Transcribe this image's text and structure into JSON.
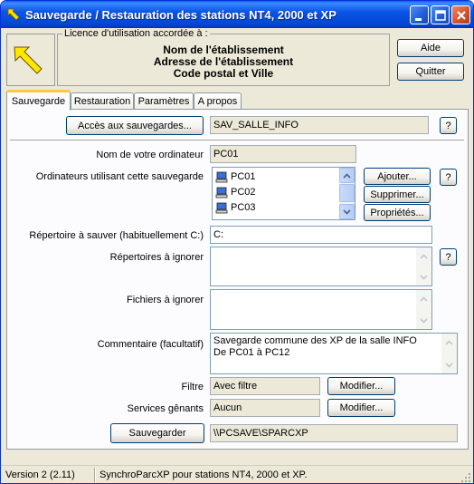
{
  "window": {
    "title": "Sauvegarde / Restauration des stations NT4, 2000 et XP"
  },
  "license": {
    "caption": "Licence d'utilisation accordée à :",
    "line1": "Nom de l'établissement",
    "line2": "Adresse de l'établissement",
    "line3": "Code postal et Ville"
  },
  "top_buttons": {
    "help": "Aide",
    "quit": "Quitter"
  },
  "tabs": [
    {
      "label": "Sauvegarde",
      "active": true
    },
    {
      "label": "Restauration",
      "active": false
    },
    {
      "label": "Paramètres",
      "active": false
    },
    {
      "label": "A propos",
      "active": false
    }
  ],
  "backup_access": {
    "button": "Accès aux sauvegardes...",
    "value": "SAV_SALLE_INFO",
    "help": "?"
  },
  "computer_name": {
    "label": "Nom de votre ordinateur",
    "value": "PC01"
  },
  "computers": {
    "label": "Ordinateurs utilisant cette sauvegarde",
    "items": [
      "PC01",
      "PC02",
      "PC03"
    ],
    "add": "Ajouter...",
    "remove": "Supprimer...",
    "properties": "Propriétés...",
    "help": "?"
  },
  "backup_dir": {
    "label": "Répertoire à sauver (habituellement C:)",
    "value": "C:"
  },
  "ignored_dirs": {
    "label": "Répertoires à ignorer",
    "value": "",
    "help": "?"
  },
  "ignored_files": {
    "label": "Fichiers à ignorer",
    "value": ""
  },
  "comment": {
    "label": "Commentaire (facultatif)",
    "line1": "Savegarde commune des XP de la salle INFO",
    "line2": "De PC01 à PC12"
  },
  "filter": {
    "label": "Filtre",
    "value": "Avec filtre",
    "button": "Modifier..."
  },
  "services": {
    "label": "Services gênants",
    "value": "Aucun",
    "button": "Modifier..."
  },
  "save": {
    "button": "Sauvegarder",
    "path": "\\\\PCSAVE\\SPARCXP"
  },
  "status": {
    "version": "Version 2 (2.11)",
    "description": "SynchroParcXP pour stations NT4, 2000 et XP."
  }
}
